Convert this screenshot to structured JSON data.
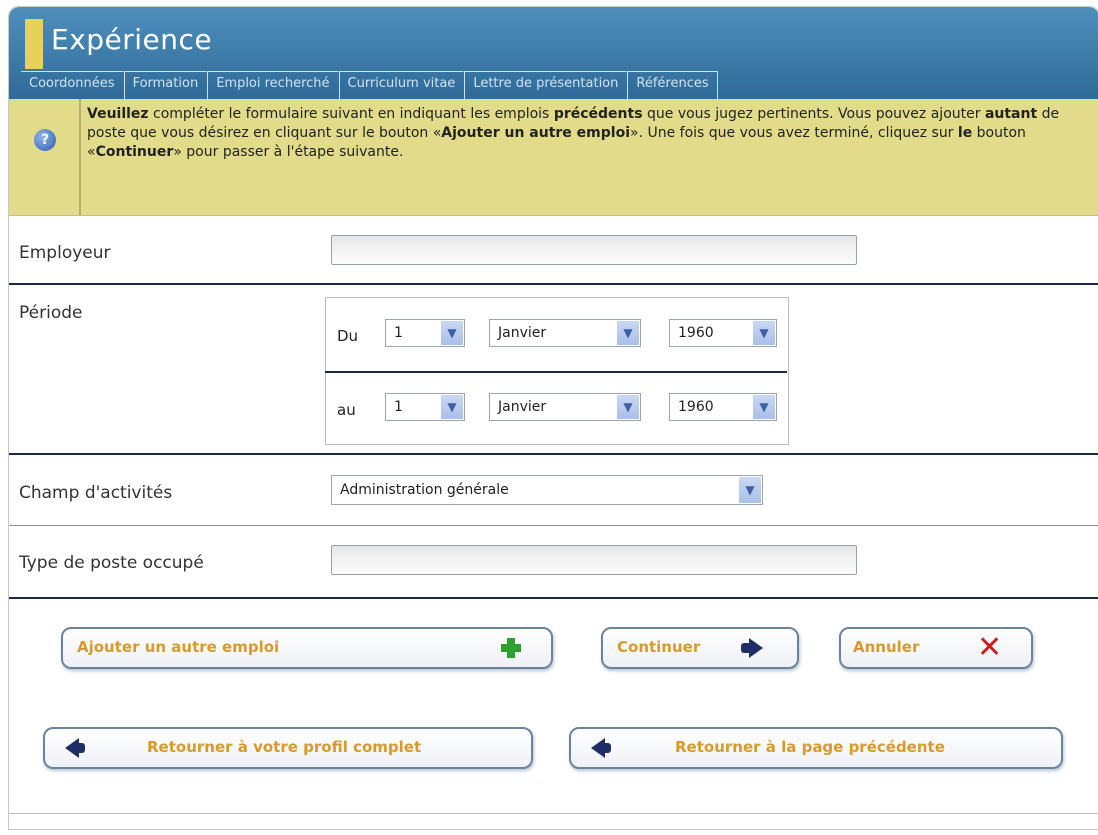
{
  "header": {
    "title": "Expérience",
    "tabs": [
      "Coordonnées",
      "Formation",
      "Emploi recherché",
      "Curriculum vitae",
      "Lettre de présentation",
      "Références"
    ]
  },
  "info": {
    "icon": "help-icon",
    "p1": "Veuillez",
    "p2": " compléter le formulaire suivant en indiquant les emplois ",
    "p3": "précédents",
    "p4": " que vous jugez pertinents. Vous pouvez ajouter ",
    "p5": "autant",
    "p6": " de poste que vous désirez en cliquant sur le bouton «",
    "p7": "Ajouter un autre emploi",
    "p8": "». Une fois que vous avez terminé, cliquez sur ",
    "p9": "le",
    "p10": " bouton «",
    "p11": "Continuer",
    "p12": "» pour passer à l'étape suivante."
  },
  "form": {
    "employer_label": "Employeur",
    "employer_value": "",
    "period_label": "Période",
    "from_label": "Du",
    "to_label": "au",
    "from_day": "1",
    "from_month": "Janvier",
    "from_year": "1960",
    "to_day": "1",
    "to_month": "Janvier",
    "to_year": "1960",
    "activity_label": "Champ d'activités",
    "activity_value": "Administration générale",
    "position_label": "Type de poste occupé",
    "position_value": ""
  },
  "buttons": {
    "add": "Ajouter un autre emploi",
    "continue": "Continuer",
    "cancel": "Annuler",
    "back_profile": "Retourner à votre profil complet",
    "back_previous": "Retourner à la page précédente"
  },
  "colors": {
    "header_blue": "#2f6a98",
    "info_yellow": "#e2dc8a",
    "button_text": "#d89b2a"
  }
}
